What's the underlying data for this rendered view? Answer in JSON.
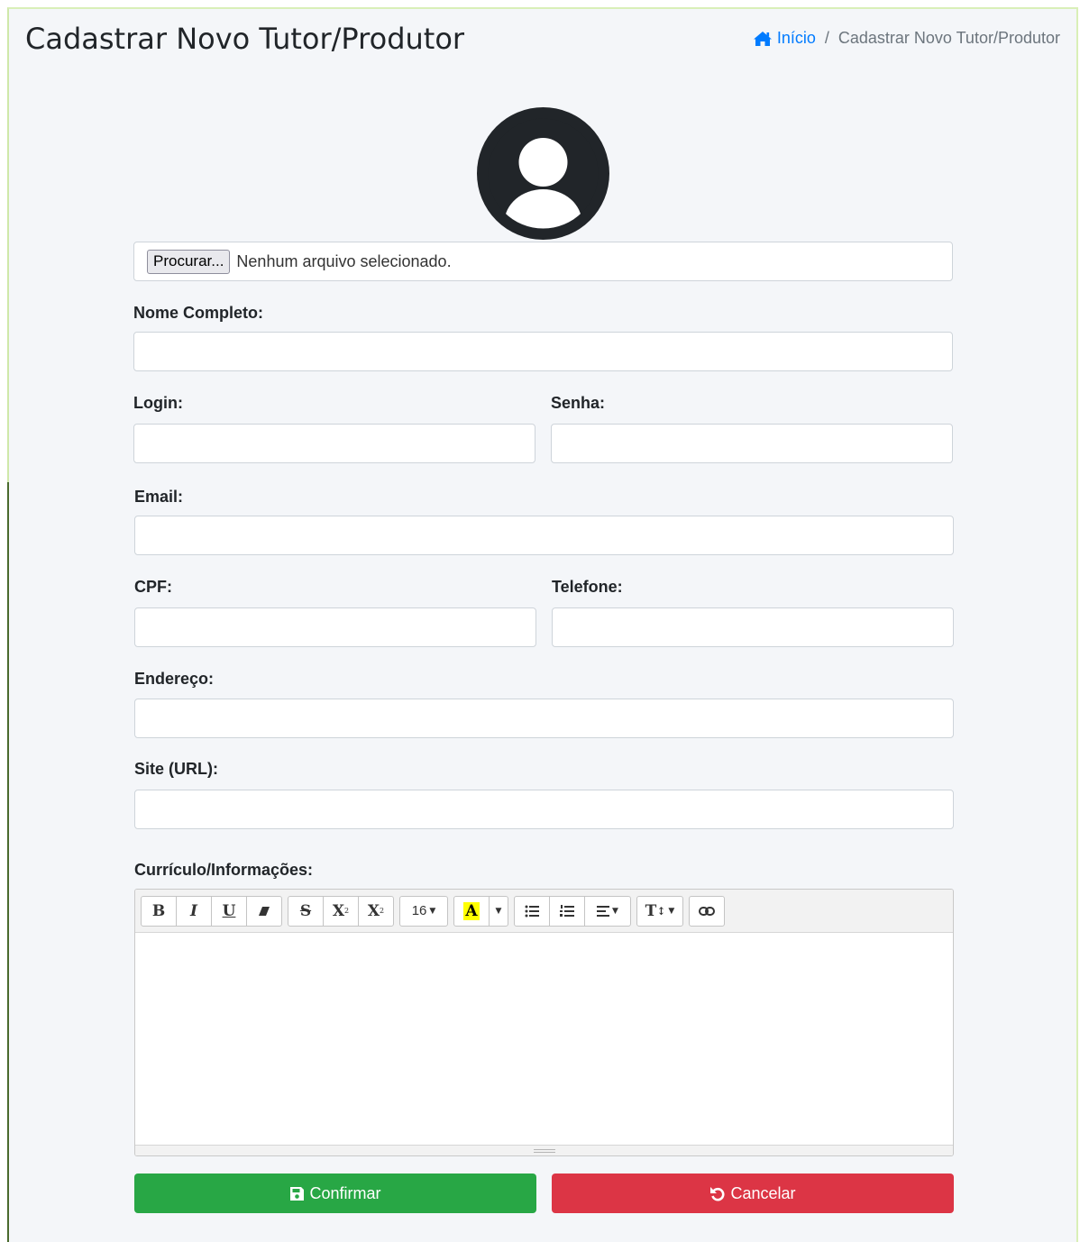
{
  "header": {
    "title": "Cadastrar Novo Tutor/Produtor",
    "breadcrumb": {
      "home": "Início",
      "separator": "/",
      "current": "Cadastrar Novo Tutor/Produtor"
    }
  },
  "photo": {
    "button_label": "Procurar...",
    "status": "Nenhum arquivo selecionado."
  },
  "fields": {
    "nome": {
      "label": "Nome Completo:",
      "value": ""
    },
    "login": {
      "label": "Login:",
      "value": ""
    },
    "senha": {
      "label": "Senha:",
      "value": ""
    },
    "email": {
      "label": "Email:",
      "value": ""
    },
    "cpf": {
      "label": "CPF:",
      "value": ""
    },
    "telefone": {
      "label": "Telefone:",
      "value": ""
    },
    "endereco": {
      "label": "Endereço:",
      "value": ""
    },
    "site": {
      "label": "Site (URL):",
      "value": ""
    },
    "curriculo": {
      "label": "Currículo/Informações:"
    }
  },
  "editor": {
    "bold": "B",
    "italic": "I",
    "underline": "U",
    "strikethrough": "S",
    "superscript": "X",
    "subscript": "X",
    "font_size": "16",
    "color": "A",
    "style": "T"
  },
  "actions": {
    "confirm": "Confirmar",
    "cancel": "Cancelar"
  },
  "colors": {
    "primary": "#007bff",
    "success": "#28a745",
    "danger": "#dc3545",
    "background": "#f4f6f9"
  }
}
